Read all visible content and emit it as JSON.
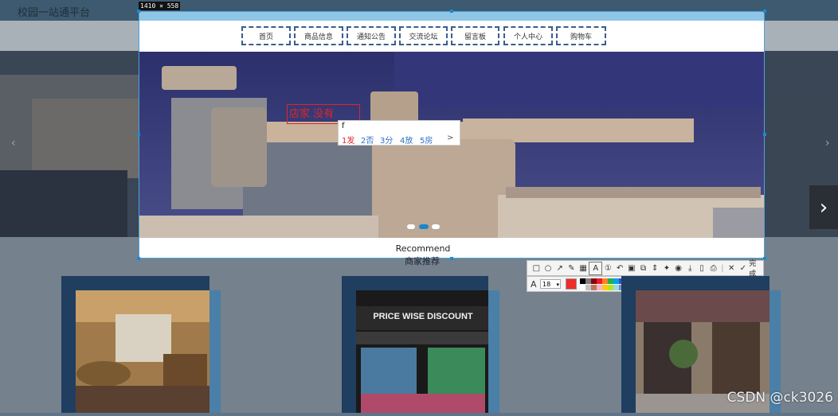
{
  "page": {
    "title": "校园一站通平台",
    "selection_size_label": "1410 × 558"
  },
  "nav": {
    "items": [
      {
        "label": "首页"
      },
      {
        "label": "商品信息"
      },
      {
        "label": "通知公告"
      },
      {
        "label": "交流论坛"
      },
      {
        "label": "留言板"
      },
      {
        "label": "个人中心"
      },
      {
        "label": "购物车"
      }
    ]
  },
  "annotation": {
    "text": "店家 没有"
  },
  "ime": {
    "input": "f",
    "candidates": [
      "1发",
      "2否",
      "3分",
      "4放",
      "5房"
    ],
    "more_label": ">"
  },
  "section": {
    "title_en": "Recommend",
    "title_zh": "商家推荐"
  },
  "toolbar": {
    "done_label": "完成",
    "font_size": "18",
    "active_color": "#ef2b2b",
    "palette": [
      "#000000",
      "#7f7f7f",
      "#880015",
      "#ed1c24",
      "#ff7f27",
      "#22b14c",
      "#00a2e8",
      "#3f48cc",
      "#a349a4",
      "#00b3b3",
      "#ffffff",
      "#c3c3c3",
      "#b97a57",
      "#ffaec9",
      "#ffc90e",
      "#b5e61d",
      "#99d9ea",
      "#7092be",
      "#c8bfe7",
      "#5a8fd0"
    ]
  },
  "watermark": {
    "text": "CSDN @ck3026"
  },
  "slider": {
    "active_dot_index": 1,
    "dot_count": 3
  }
}
